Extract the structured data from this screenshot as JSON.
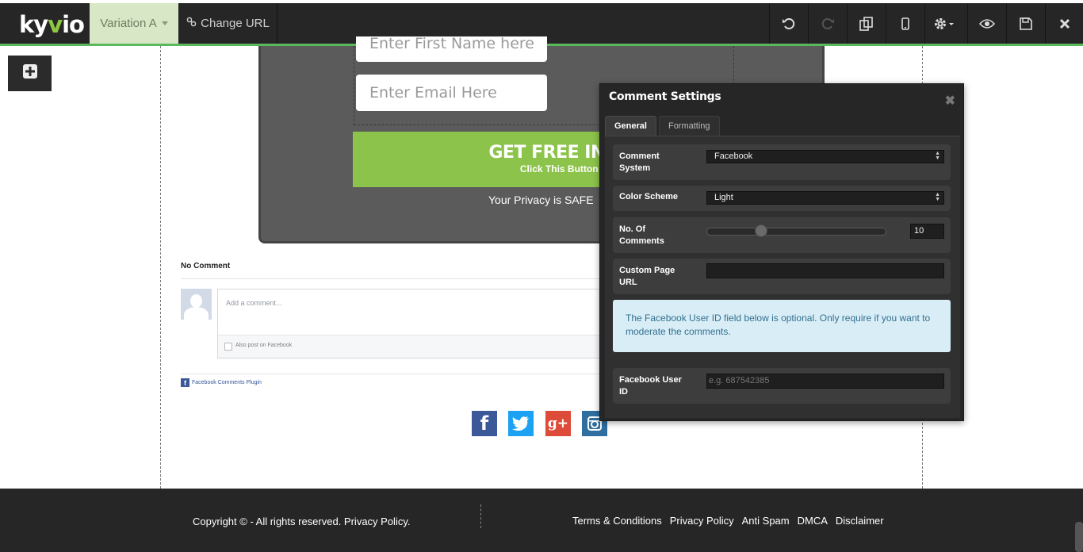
{
  "toolbar": {
    "logo_prefix": "ky",
    "logo_accent": "v",
    "logo_suffix": "io",
    "variation_label": "Variation A",
    "change_url_label": "Change URL",
    "accent_color": "#5cb85c",
    "buttons": [
      "undo-icon",
      "redo-icon",
      "copy-icon",
      "mobile-icon",
      "gear-icon",
      "eye-icon",
      "save-icon",
      "close-icon"
    ]
  },
  "canvas": {
    "first_name_placeholder": "Enter First Name here",
    "email_placeholder": "Enter Email Here",
    "cta_title": "GET FREE INSTANT A",
    "cta_subtitle": "Click This Button To Join Tod",
    "privacy_text": "Your Privacy is SAFE"
  },
  "facebook_comments": {
    "title": "No Comment",
    "placeholder": "Add a comment...",
    "also_post": "Also post on Facebook",
    "plugin_label": "Facebook Comments Plugin"
  },
  "social_icons": [
    "facebook-icon",
    "twitter-icon",
    "google-plus-icon",
    "instagram-icon"
  ],
  "footer": {
    "copyright": "Copyright © - All rights reserved. Privacy Policy.",
    "links": [
      "Terms & Conditions",
      "Privacy Policy",
      "Anti Spam",
      "DMCA",
      "Disclaimer"
    ]
  },
  "panel": {
    "title": "Comment Settings",
    "tabs": [
      "General",
      "Formatting"
    ],
    "active_tab": "General",
    "comment_system_label": "Comment System",
    "comment_system_value": "Facebook",
    "color_scheme_label": "Color Scheme",
    "color_scheme_value": "Light",
    "num_comments_label": "No. Of Comments",
    "num_comments_value": "10",
    "custom_url_label": "Custom Page URL",
    "custom_url_value": "",
    "info_text": "The Facebook User ID field below is optional. Only require if you want to moderate the comments.",
    "user_id_label": "Facebook User ID",
    "user_id_placeholder": "e.g. 687542385"
  }
}
